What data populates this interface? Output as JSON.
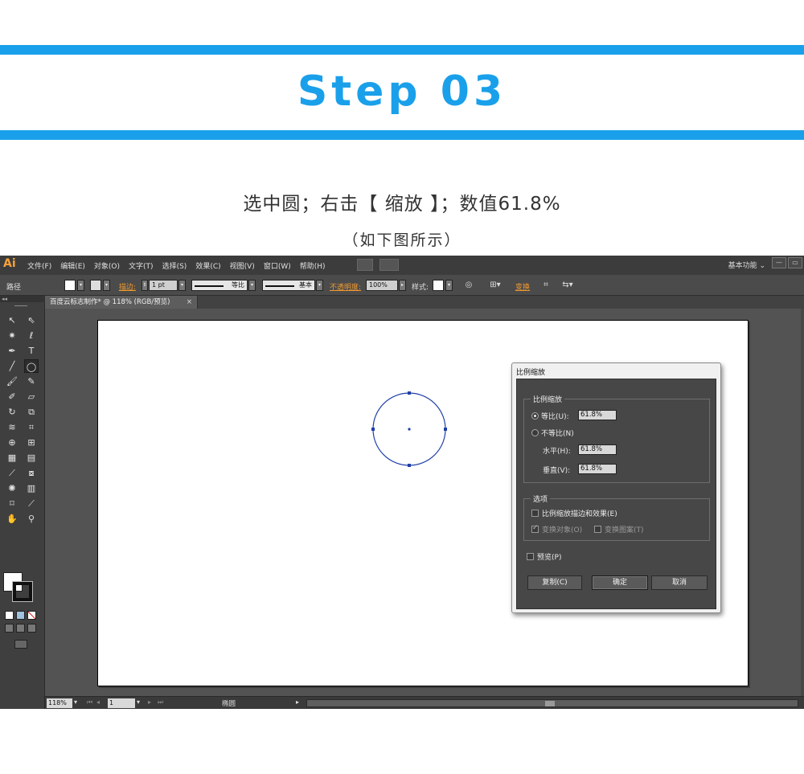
{
  "tutorial": {
    "step_title": "Step 03",
    "instruction": "选中圆；右击【 缩放 】；数值61.8%",
    "caption": "（如下图所示）"
  },
  "app": {
    "logo": "Ai",
    "menu": [
      "文件(F)",
      "编辑(E)",
      "对象(O)",
      "文字(T)",
      "选择(S)",
      "效果(C)",
      "视图(V)",
      "窗口(W)",
      "帮助(H)"
    ],
    "workspace": "基本功能 ⌄",
    "window_buttons": [
      "—",
      "▭"
    ],
    "control_bar": {
      "selection_label": "路径",
      "stroke_label": "描边:",
      "stroke_weight": "1 pt",
      "profile_label": "等比",
      "brush_label": "基本",
      "opacity_label": "不透明度:",
      "opacity_value": "100%",
      "style_label": "样式:",
      "transform_label": "变换"
    },
    "document_tab": {
      "title": "百度云标志制作* @ 118% (RGB/预览)",
      "close": "×"
    },
    "status": {
      "zoom": "118%",
      "page": "1",
      "tool_name": "椭圆"
    },
    "toolbox_grip": "◂◂"
  },
  "dialog": {
    "title": "比例缩放",
    "group_scale": "比例缩放",
    "uniform_label": "等比(U):",
    "uniform_value": "61.8%",
    "nonuniform_label": "不等比(N)",
    "horizontal_label": "水平(H):",
    "horizontal_value": "61.8%",
    "vertical_label": "垂直(V):",
    "vertical_value": "61.8%",
    "group_options": "选项",
    "scale_strokes_label": "比例缩放描边和效果(E)",
    "transform_objects_label": "变换对象(O)",
    "transform_patterns_label": "变换图案(T)",
    "preview_label": "预览(P)",
    "copy_button": "复制(C)",
    "ok_button": "确定",
    "cancel_button": "取消"
  },
  "colors": {
    "accent": "#1aa0ea",
    "selection_path": "#1f3fa8",
    "ui_dark": "#535353",
    "orange_label": "#f39a2d"
  },
  "icons": [
    "selection-tool-icon",
    "direct-selection-tool-icon",
    "magic-wand-icon",
    "lasso-icon",
    "pen-tool-icon",
    "type-tool-icon",
    "line-tool-icon",
    "ellipse-tool-icon",
    "paintbrush-icon",
    "pencil-icon",
    "blob-brush-icon",
    "eraser-icon",
    "rotate-icon",
    "scale-icon",
    "warp-icon",
    "free-transform-icon",
    "shape-builder-icon",
    "graph-icon",
    "mesh-icon",
    "gradient-icon",
    "eyedropper-icon",
    "blend-icon",
    "symbol-sprayer-icon",
    "column-graph-icon",
    "artboard-icon",
    "slice-icon",
    "hand-icon",
    "zoom-icon"
  ]
}
